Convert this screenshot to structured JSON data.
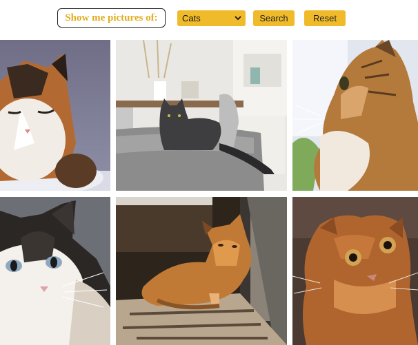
{
  "toolbar": {
    "prompt_label": "Show me pictures of:",
    "select_value": "Cats",
    "search_label": "Search",
    "reset_label": "Reset",
    "accent_color": "#f0bb2a"
  },
  "gallery": {
    "photos": [
      {
        "icon": "calico-cat-photo"
      },
      {
        "icon": "gray-cat-on-sofa-photo"
      },
      {
        "icon": "tabby-cat-profile-photo"
      },
      {
        "icon": "fluffy-cat-blue-eyes-photo"
      },
      {
        "icon": "orange-cat-in-sunlight-photo"
      },
      {
        "icon": "ginger-fold-cat-photo"
      }
    ]
  }
}
